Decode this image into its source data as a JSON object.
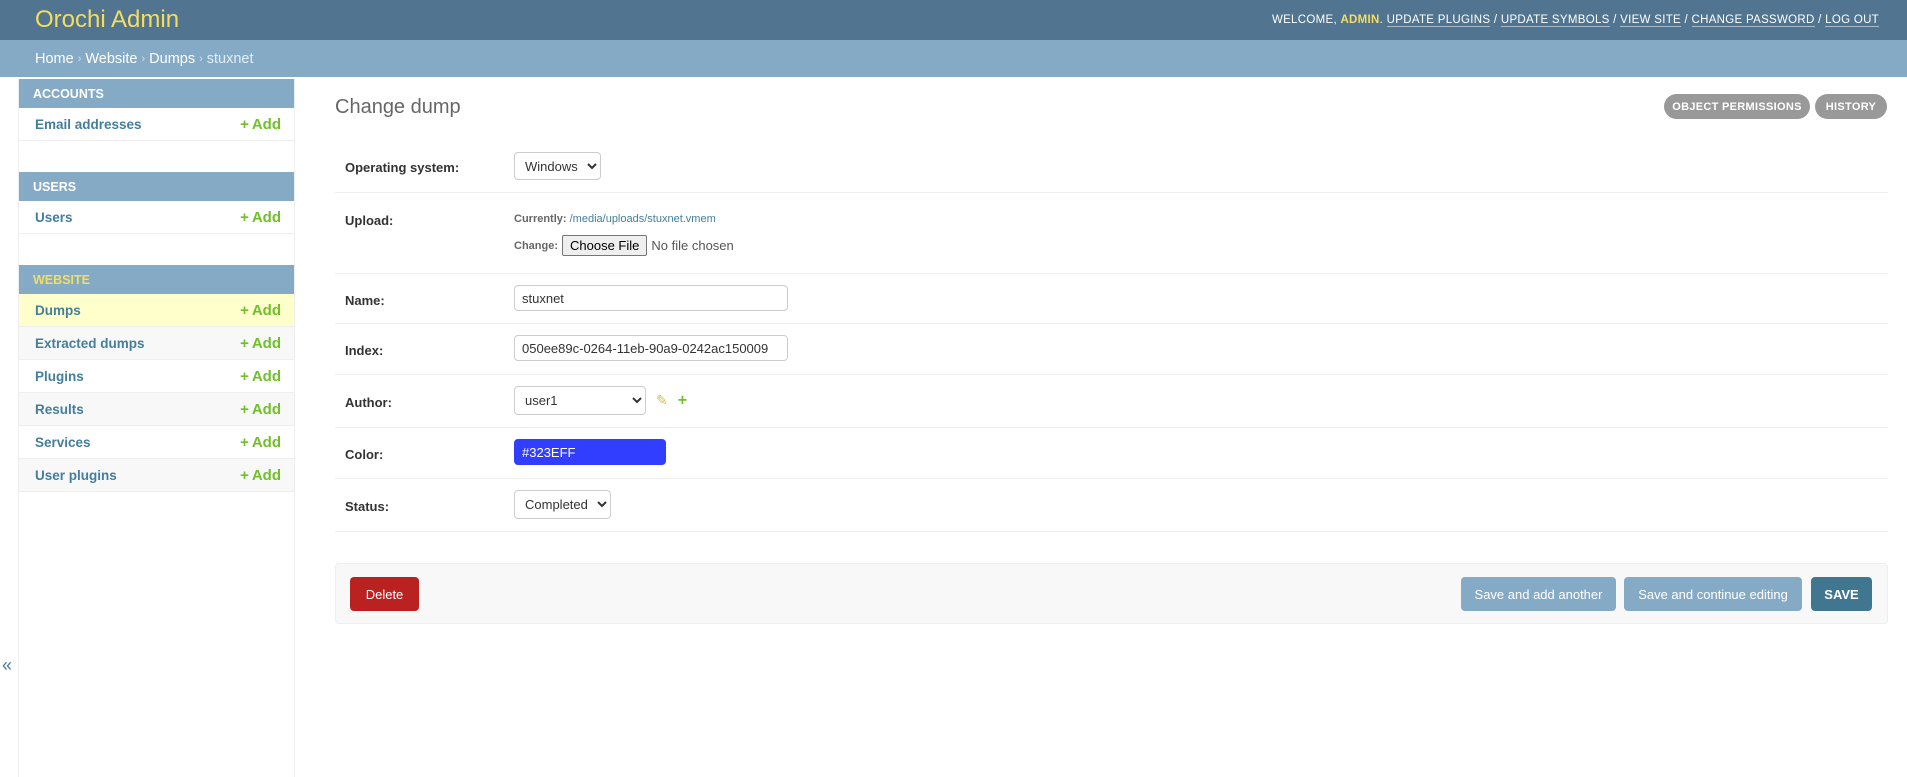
{
  "header": {
    "title": "Orochi Admin",
    "welcome": "Welcome, ",
    "user": "admin",
    "links": [
      "Update plugins",
      "Update symbols",
      "View site",
      "Change password",
      "Log out"
    ]
  },
  "breadcrumbs": [
    "Home",
    "Website",
    "Dumps",
    "stuxnet"
  ],
  "sidebar": {
    "add_label": "Add",
    "toggle": "«",
    "modules": [
      {
        "title": "Accounts",
        "items": [
          "Email addresses"
        ]
      },
      {
        "title": "Users",
        "items": [
          "Users"
        ]
      },
      {
        "title": "Website",
        "items": [
          "Dumps",
          "Extracted dumps",
          "Plugins",
          "Results",
          "Services",
          "User plugins"
        ]
      }
    ]
  },
  "main": {
    "title": "Change dump",
    "tools": [
      "Object permissions",
      "History"
    ],
    "fields": {
      "os_label": "Operating system:",
      "os_value": "Windows",
      "upload_label": "Upload:",
      "currently": "Currently:",
      "current_file": "/media/uploads/stuxnet.vmem",
      "change": "Change:",
      "choose_file": "Choose File",
      "no_file": "No file chosen",
      "name_label": "Name:",
      "name_value": "stuxnet",
      "index_label": "Index:",
      "index_value": "050ee89c-0264-11eb-90a9-0242ac150009",
      "author_label": "Author:",
      "author_value": "user1",
      "color_label": "Color:",
      "color_value": "#323EFF",
      "status_label": "Status:",
      "status_value": "Completed"
    },
    "buttons": {
      "delete": "Delete",
      "save_add": "Save and add another",
      "save_continue": "Save and continue editing",
      "save": "SAVE"
    }
  },
  "colors": {
    "header": "#517591",
    "breadcrumb": "#85aac6",
    "accent": "#f5dd5d",
    "delete": "#ba2121",
    "save": "#417690",
    "swatch": "#323EFF"
  }
}
